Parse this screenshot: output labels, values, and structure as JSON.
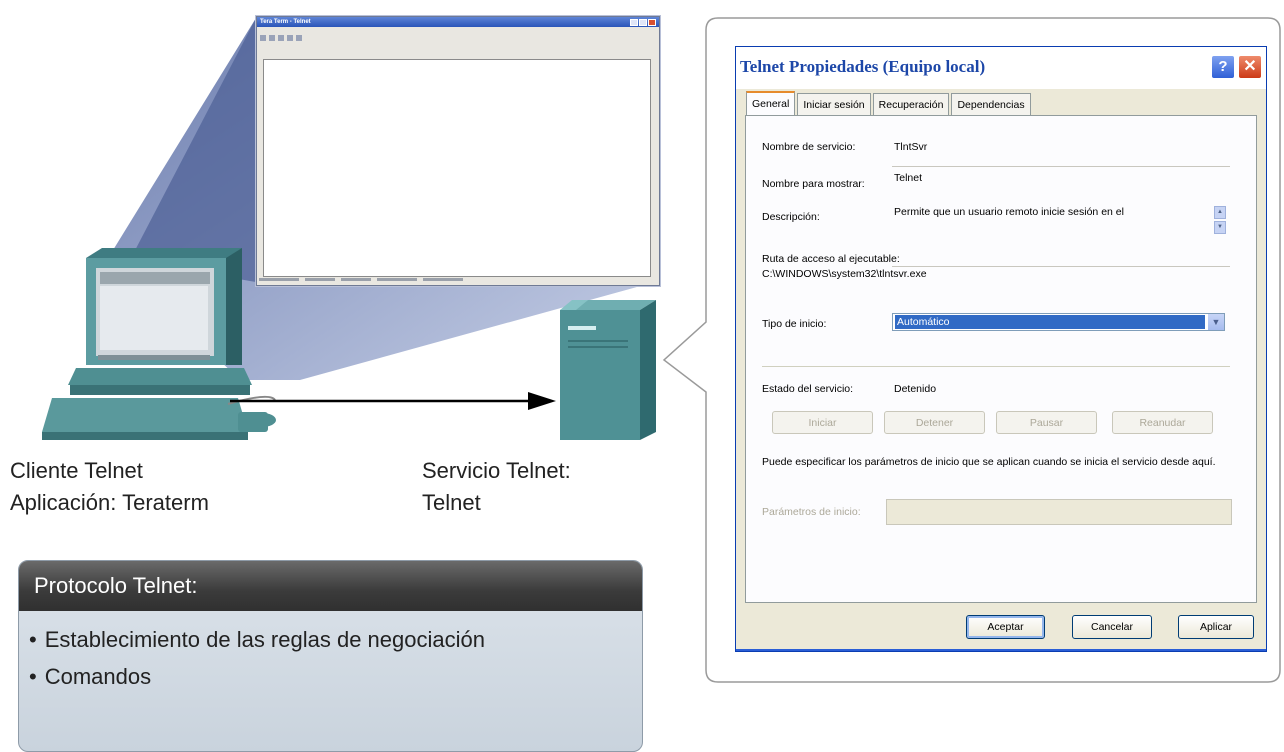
{
  "labels": {
    "client_line1": "Cliente Telnet",
    "client_line2": "Aplicación: Teraterm",
    "service_line1": "Servicio Telnet:",
    "service_line2": "Telnet"
  },
  "protocol_box": {
    "title": "Protocolo Telnet:",
    "items": [
      "Establecimiento de las reglas de negociación",
      "Comandos"
    ]
  },
  "dialog": {
    "title": "Telnet Propiedades (Equipo local)",
    "help_icon": "question-icon",
    "close_icon": "close-icon",
    "tabs": [
      "General",
      "Iniciar sesión",
      "Recuperación",
      "Dependencias"
    ],
    "active_tab": "General",
    "fields": {
      "service_name_label": "Nombre de servicio:",
      "service_name_value": "TlntSvr",
      "display_name_label": "Nombre para mostrar:",
      "display_name_value": "Telnet",
      "description_label": "Descripción:",
      "description_value": "Permite que un usuario remoto inicie sesión en el",
      "exe_path_label": "Ruta de acceso al ejecutable:",
      "exe_path_value": "C:\\WINDOWS\\system32\\tlntsvr.exe",
      "startup_type_label": "Tipo de inicio:",
      "startup_type_value": "Automático",
      "service_status_label": "Estado del servicio:",
      "service_status_value": "Detenido"
    },
    "service_buttons": [
      "Iniciar",
      "Detener",
      "Pausar",
      "Reanudar"
    ],
    "help_text": "Puede especificar los parámetros de inicio que se aplican cuando se inicia el servicio desde aquí.",
    "start_params_label": "Parámetros de inicio:",
    "footer_buttons": {
      "ok": "Aceptar",
      "cancel": "Cancelar",
      "apply": "Aplicar"
    }
  },
  "colors": {
    "dialog_bg": "#ece9d8",
    "title_text": "#1d47a8",
    "selection": "#316ac5",
    "protocol_header": "#3b3b3b",
    "device_teal": "#4f8f92"
  }
}
